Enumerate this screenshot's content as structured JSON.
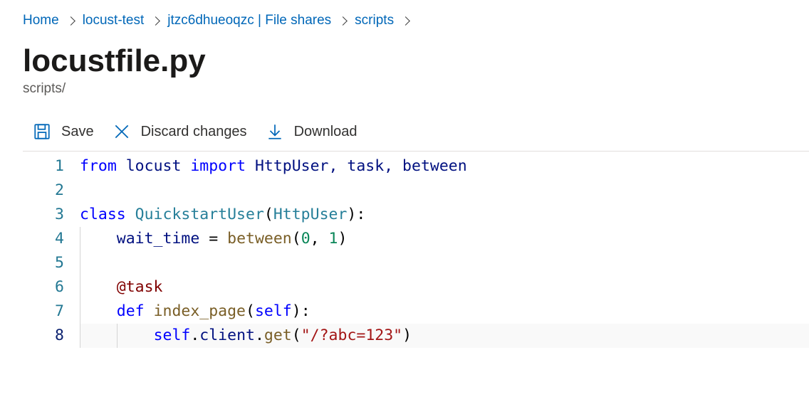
{
  "breadcrumb": {
    "items": [
      "Home",
      "locust-test",
      "jtzc6dhueoqzc | File shares",
      "scripts"
    ]
  },
  "header": {
    "title": "locustfile.py",
    "subtitle": "scripts/"
  },
  "toolbar": {
    "save": "Save",
    "discard": "Discard changes",
    "download": "Download"
  },
  "editor": {
    "active_line": 8,
    "lines": [
      {
        "n": 1,
        "tokens": [
          [
            "kw",
            "from "
          ],
          [
            "name",
            "locust "
          ],
          [
            "kw",
            "import "
          ],
          [
            "name",
            "HttpUser, task, between"
          ]
        ]
      },
      {
        "n": 2,
        "tokens": []
      },
      {
        "n": 3,
        "tokens": [
          [
            "kw",
            "class "
          ],
          [
            "cls",
            "QuickstartUser"
          ],
          [
            "py-sym",
            "("
          ],
          [
            "cls",
            "HttpUser"
          ],
          [
            "py-sym",
            "):"
          ]
        ]
      },
      {
        "n": 4,
        "indent": 1,
        "tokens": [
          [
            "name",
            "wait_time "
          ],
          [
            "py-sym",
            "= "
          ],
          [
            "fn",
            "between"
          ],
          [
            "py-sym",
            "("
          ],
          [
            "num",
            "0"
          ],
          [
            "py-sym",
            ", "
          ],
          [
            "num",
            "1"
          ],
          [
            "py-sym",
            ")"
          ]
        ]
      },
      {
        "n": 5,
        "indent": 1,
        "tokens": []
      },
      {
        "n": 6,
        "indent": 1,
        "tokens": [
          [
            "at",
            "@task"
          ]
        ]
      },
      {
        "n": 7,
        "indent": 1,
        "tokens": [
          [
            "kw",
            "def "
          ],
          [
            "fn",
            "index_page"
          ],
          [
            "py-sym",
            "("
          ],
          [
            "self",
            "self"
          ],
          [
            "py-sym",
            "):"
          ]
        ]
      },
      {
        "n": 8,
        "indent": 2,
        "tokens": [
          [
            "self",
            "self"
          ],
          [
            "py-sym",
            "."
          ],
          [
            "name",
            "client"
          ],
          [
            "py-sym",
            "."
          ],
          [
            "fn",
            "get"
          ],
          [
            "py-sym",
            "("
          ],
          [
            "str",
            "\"/?abc=123\""
          ],
          [
            "py-sym",
            ")"
          ]
        ]
      }
    ]
  }
}
